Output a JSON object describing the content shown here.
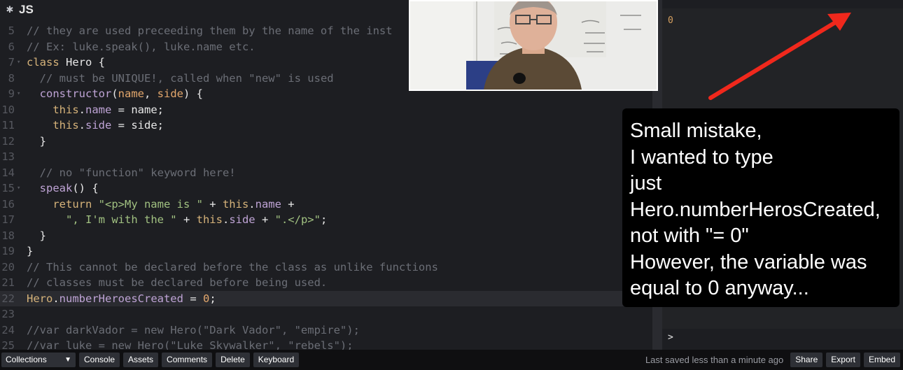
{
  "editor": {
    "title": "JS",
    "gear_icon": "gear-icon",
    "lines": [
      {
        "n": "5",
        "fold": "",
        "active": false,
        "tokens": [
          [
            "cm",
            "// they are used preceeding them by the name of the inst"
          ]
        ]
      },
      {
        "n": "6",
        "fold": "",
        "active": false,
        "tokens": [
          [
            "cm",
            "// Ex: luke.speak(), luke.name etc."
          ]
        ]
      },
      {
        "n": "7",
        "fold": "▾",
        "active": false,
        "tokens": [
          [
            "kw",
            "class "
          ],
          [
            "tx",
            "Hero {"
          ]
        ]
      },
      {
        "n": "8",
        "fold": "",
        "active": false,
        "tokens": [
          [
            "tx",
            "  "
          ],
          [
            "cm",
            "// must be UNIQUE!, called when \"new\" is used"
          ]
        ]
      },
      {
        "n": "9",
        "fold": "▾",
        "active": false,
        "tokens": [
          [
            "tx",
            "  "
          ],
          [
            "fn",
            "constructor"
          ],
          [
            "tx",
            "("
          ],
          [
            "nm",
            "name"
          ],
          [
            "tx",
            ", "
          ],
          [
            "nm",
            "side"
          ],
          [
            "tx",
            ") {"
          ]
        ]
      },
      {
        "n": "10",
        "fold": "",
        "active": false,
        "tokens": [
          [
            "tx",
            "    "
          ],
          [
            "th",
            "this"
          ],
          [
            "tx",
            "."
          ],
          [
            "pr",
            "name"
          ],
          [
            "tx",
            " = name;"
          ]
        ]
      },
      {
        "n": "11",
        "fold": "",
        "active": false,
        "tokens": [
          [
            "tx",
            "    "
          ],
          [
            "th",
            "this"
          ],
          [
            "tx",
            "."
          ],
          [
            "pr",
            "side"
          ],
          [
            "tx",
            " = side;"
          ]
        ]
      },
      {
        "n": "12",
        "fold": "",
        "active": false,
        "tokens": [
          [
            "tx",
            "  }"
          ]
        ]
      },
      {
        "n": "13",
        "fold": "",
        "active": false,
        "tokens": []
      },
      {
        "n": "14",
        "fold": "",
        "active": false,
        "tokens": [
          [
            "tx",
            "  "
          ],
          [
            "cm",
            "// no \"function\" keyword here!"
          ]
        ]
      },
      {
        "n": "15",
        "fold": "▾",
        "active": false,
        "tokens": [
          [
            "tx",
            "  "
          ],
          [
            "fn",
            "speak"
          ],
          [
            "tx",
            "() {"
          ]
        ]
      },
      {
        "n": "16",
        "fold": "",
        "active": false,
        "tokens": [
          [
            "tx",
            "    "
          ],
          [
            "kw",
            "return "
          ],
          [
            "st",
            "\"<p>My name is \""
          ],
          [
            "tx",
            " + "
          ],
          [
            "th",
            "this"
          ],
          [
            "tx",
            "."
          ],
          [
            "pr",
            "name"
          ],
          [
            "tx",
            " +"
          ]
        ]
      },
      {
        "n": "17",
        "fold": "",
        "active": false,
        "tokens": [
          [
            "tx",
            "      "
          ],
          [
            "st",
            "\", I'm with the \""
          ],
          [
            "tx",
            " + "
          ],
          [
            "th",
            "this"
          ],
          [
            "tx",
            "."
          ],
          [
            "pr",
            "side"
          ],
          [
            "tx",
            " + "
          ],
          [
            "st",
            "\".</p>\""
          ],
          [
            "tx",
            ";"
          ]
        ]
      },
      {
        "n": "18",
        "fold": "",
        "active": false,
        "tokens": [
          [
            "tx",
            "  }"
          ]
        ]
      },
      {
        "n": "19",
        "fold": "",
        "active": false,
        "tokens": [
          [
            "tx",
            "}"
          ]
        ]
      },
      {
        "n": "20",
        "fold": "",
        "active": false,
        "tokens": [
          [
            "cm",
            "// This cannot be declared before the class as unlike functions"
          ]
        ]
      },
      {
        "n": "21",
        "fold": "",
        "active": false,
        "tokens": [
          [
            "cm",
            "// classes must be declared before being used."
          ]
        ]
      },
      {
        "n": "22",
        "fold": "",
        "active": true,
        "tokens": [
          [
            "kw",
            "Hero"
          ],
          [
            "tx",
            "."
          ],
          [
            "pr",
            "numberHeroesCreated"
          ],
          [
            "tx",
            " = "
          ],
          [
            "nm",
            "0"
          ],
          [
            "tx",
            ";"
          ]
        ]
      },
      {
        "n": "23",
        "fold": "",
        "active": false,
        "tokens": []
      },
      {
        "n": "24",
        "fold": "",
        "active": false,
        "tokens": [
          [
            "cm",
            "//var darkVador = new Hero(\"Dark Vador\", \"empire\");"
          ]
        ]
      },
      {
        "n": "25",
        "fold": "",
        "active": false,
        "tokens": [
          [
            "cm",
            "//var luke = new Hero(\"Luke Skywalker\", \"rebels\");"
          ]
        ]
      }
    ]
  },
  "result": {
    "value": "0"
  },
  "console": {
    "prompt": ">"
  },
  "caption": {
    "lines": [
      "Small mistake,",
      "I wanted to type",
      "just",
      "Hero.numberHerosCreated,",
      "not with \"= 0\"",
      "However, the variable was",
      "equal to 0 anyway..."
    ]
  },
  "bottom_bar": {
    "collections": "Collections",
    "console": "Console",
    "assets": "Assets",
    "comments": "Comments",
    "delete": "Delete",
    "keyboard": "Keyboard",
    "status": "Last saved less than a minute ago",
    "share": "Share",
    "export": "Export",
    "embed": "Embed"
  },
  "colors": {
    "arrow": "#f0281c",
    "caption_bg": "#000000",
    "editor_bg": "#1d1e22"
  }
}
